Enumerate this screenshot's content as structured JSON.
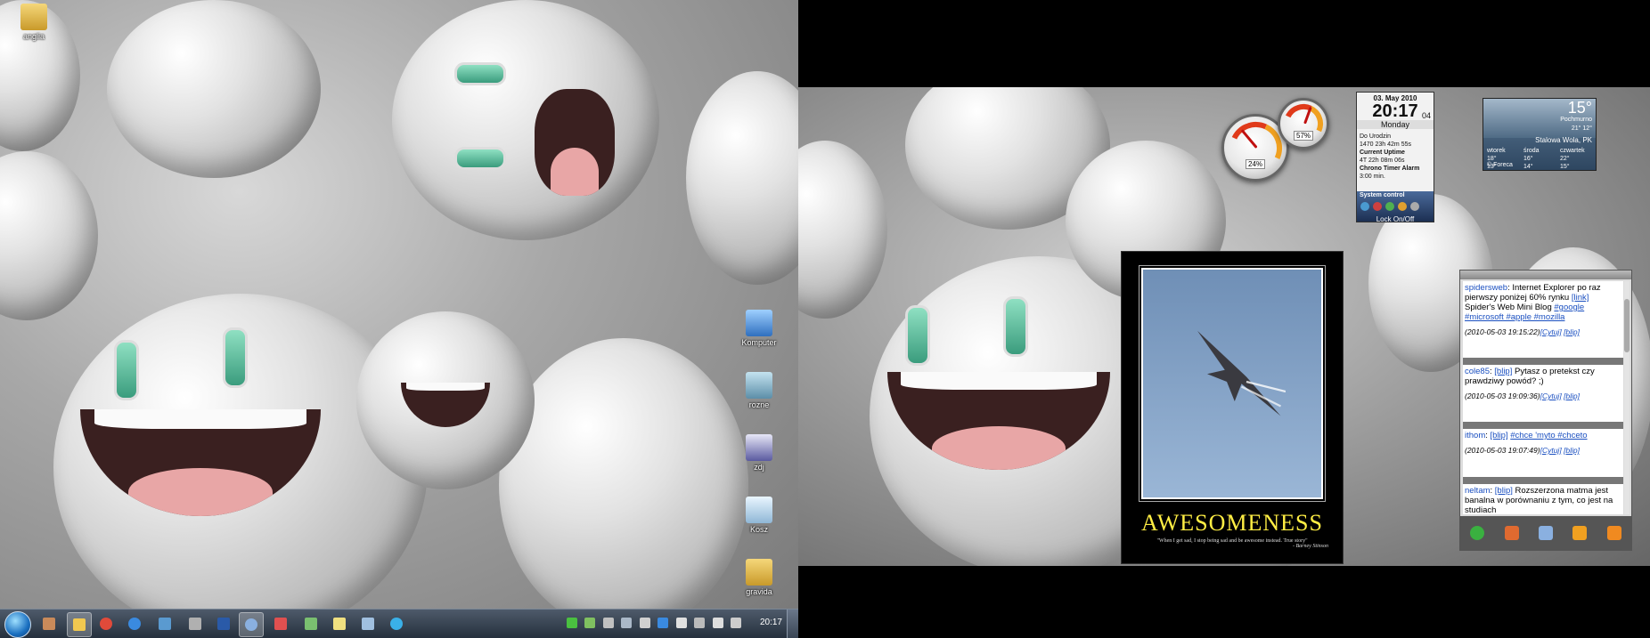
{
  "left_desktop": {
    "icons": [
      {
        "label": "anglia",
        "icon": "folder-icon"
      },
      {
        "label": "Komputer",
        "icon": "computer-icon"
      },
      {
        "label": "rozne",
        "icon": "shortcut-icon"
      },
      {
        "label": "zdj",
        "icon": "shortcut-icon"
      },
      {
        "label": "Kosz",
        "icon": "recycle-bin-icon"
      },
      {
        "label": "gravida",
        "icon": "folder-icon"
      }
    ],
    "taskbar": {
      "clock": "20:17"
    }
  },
  "gauges": {
    "cpu_label": "24%",
    "mem_label": "57%"
  },
  "calendar": {
    "date": "03. May 2010",
    "time": "20:17",
    "seconds": "04",
    "weekday": "Monday",
    "birthday_label": "Do Urodzin",
    "birthday_value": "1470 23h 42m 55s",
    "uptime_label": "Current Uptime",
    "uptime_value": "4T 22h 08m 06s",
    "chrono_label": "Chrono",
    "timer_label": "Timer",
    "alarm_label": "Alarm",
    "timer_value": "3:00 min.",
    "system_label": "System control",
    "lock_label": "Lock On/Off"
  },
  "weather": {
    "temp": "15°",
    "condition": "Pochmurno",
    "range_high": "21°",
    "range_low": "12°",
    "location": "Stalowa Wola, PK",
    "days": [
      {
        "name": "wtorek",
        "high": "18°",
        "low": "13°"
      },
      {
        "name": "środa",
        "high": "16°",
        "low": "14°"
      },
      {
        "name": "czwartek",
        "high": "22°",
        "low": "15°"
      }
    ],
    "credit": "© Foreca"
  },
  "poster": {
    "title": "AWESOMENESS",
    "quote": "\"When I get sad, I stop being sad and be awesome instead. True story\"",
    "author": "- Barney Stinson"
  },
  "blip": {
    "posts": [
      {
        "user": "spidersweb",
        "body": ": Internet Explorer po raz pierwszy poniżej 60% rynku ",
        "link": "[link]",
        "body2": " Spider's Web Mini Blog ",
        "tags": "#google #microsoft #apple #mozilla",
        "time": "(2010-05-03 19:15:22)",
        "cite": "[Cytuj]",
        "blip": "[blip]"
      },
      {
        "user": "cole85",
        "body": ": ",
        "link": "[blip]",
        "body2": " Pytasz o pretekst czy prawdziwy powód? ;)",
        "tags": "",
        "time": "(2010-05-03 19:09:36)",
        "cite": "[Cytuj]",
        "blip": "[blip]"
      },
      {
        "user": "ithom",
        "body": ": ",
        "link": "[blip]",
        "body2": " ",
        "tags": "#chce 'myto #chceto",
        "time": "(2010-05-03 19:07:49)",
        "cite": "[Cytuj]",
        "blip": "[blip]"
      },
      {
        "user": "neltam",
        "body": ": ",
        "link": "[blip]",
        "body2": " Rozszerzona matma jest banalna w porównaniu z tym, co jest na studiach",
        "tags": "",
        "time": "",
        "cite": "",
        "blip": ""
      }
    ]
  },
  "colors": {
    "accent_link": "#1a4fc0",
    "poster_title": "#ffee44",
    "gauge_needle": "#c01010"
  }
}
